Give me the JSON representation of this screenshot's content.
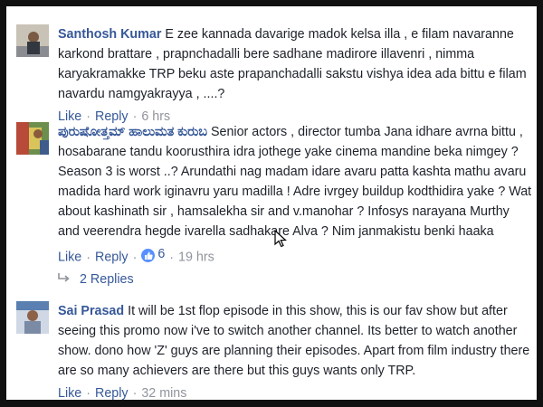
{
  "comments": [
    {
      "author": "Santhosh Kumar",
      "text": "E zee kannada davarige madok kelsa illa , e filam navaranne karkond brattare , prapnchadalli bere sadhane madirore illavenri , nimma karyakramakke TRP beku aste prapanchadalli sakstu vishya idea ada bittu e filam navardu namgyakrayya , ....?",
      "like_label": "Like",
      "reply_label": "Reply",
      "time": "6 hrs"
    },
    {
      "author": "ಪುರುಷೋತ್ತಮ್ ಹಾಲುಮತ ಕುರುಬ",
      "text": "Senior actors , director tumba Jana idhare avrna bittu , hosabarane tandu koorusthira idra jothege yake cinema mandine beka nimgey ? Season 3 is worst ..? Arundathi nag madam idare avaru patta kashta mathu avaru madida hard work iginavru yaru madilla ! Adre ivrgey buildup kodthidira yake ? Wat about kashinath sir , hamsalekha sir and v.manohar ? Infosys narayana Murthy and veerendra hegde ivarella sadhakare Alva ? Nim janmakistu benki haaka",
      "like_label": "Like",
      "reply_label": "Reply",
      "like_count": "6",
      "time": "19 hrs",
      "replies_label": "2 Replies"
    },
    {
      "author": "Sai Prasad",
      "text": "It will be 1st flop episode in this show, this is our fav show but after seeing this promo now i've to switch another channel. Its better to watch another show. dono how 'Z' guys are planning their episodes. Apart from film industry there are so many achievers are there but this guys wants only TRP.",
      "like_label": "Like",
      "reply_label": "Reply",
      "time": "32 mins"
    }
  ],
  "separator": "·"
}
